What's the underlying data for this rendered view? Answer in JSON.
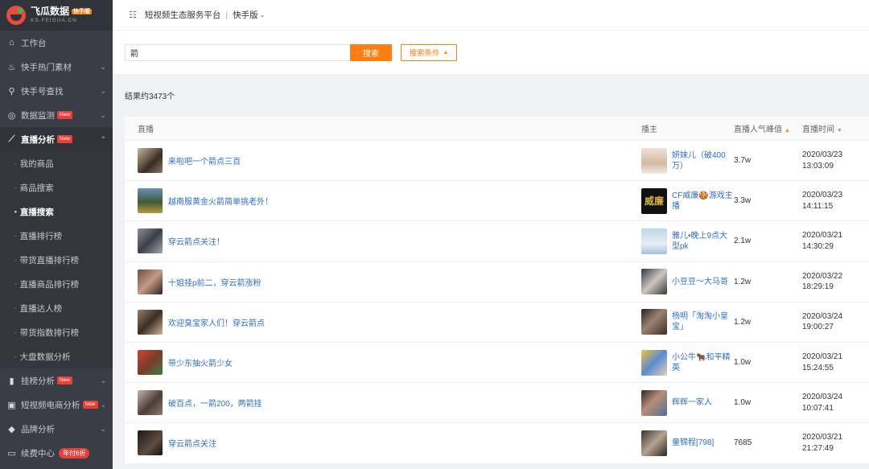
{
  "brand": {
    "name": "飞瓜数据",
    "badge": "快手版",
    "domain": "KS.FEIGUA.CN"
  },
  "sidebar": {
    "items": [
      {
        "label": "工作台",
        "icon": "home-icon",
        "glyph": "⌂",
        "caret": ""
      },
      {
        "label": "快手热门素材",
        "icon": "flame-icon",
        "glyph": "♨",
        "caret": "⌄"
      },
      {
        "label": "快手号查找",
        "icon": "search-icon",
        "glyph": "⚲",
        "caret": "⌄"
      },
      {
        "label": "数据监测",
        "icon": "monitor-icon",
        "glyph": "◎",
        "caret": "⌄",
        "badge": "New"
      },
      {
        "label": "直播分析",
        "icon": "trend-icon",
        "glyph": "⟋",
        "caret": "⌃",
        "badge": "New"
      }
    ],
    "sub_items": [
      {
        "label": "我的商品",
        "dot": "·"
      },
      {
        "label": "商品搜索",
        "dot": "·"
      },
      {
        "label": "直播搜索",
        "dot": "•"
      },
      {
        "label": "直播排行榜",
        "dot": "·"
      },
      {
        "label": "带货直播排行榜",
        "dot": "·"
      },
      {
        "label": "直播商品排行榜",
        "dot": "·"
      },
      {
        "label": "直播达人榜",
        "dot": "·"
      },
      {
        "label": "带货指数排行榜",
        "dot": "·"
      },
      {
        "label": "大盘数据分析",
        "dot": "·"
      }
    ],
    "bottom_items": [
      {
        "label": "挂榜分析",
        "icon": "bar-chart-icon",
        "glyph": "▮",
        "caret": "⌄",
        "badge": "New"
      },
      {
        "label": "短视频电商分析",
        "icon": "bag-icon",
        "glyph": "▣",
        "caret": "⌄",
        "badge": "New"
      },
      {
        "label": "品牌分析",
        "icon": "diamond-icon",
        "glyph": "◆",
        "caret": "⌄"
      },
      {
        "label": "续费中心",
        "icon": "card-icon",
        "glyph": "▭",
        "caret": "",
        "pill": "年付6折"
      }
    ]
  },
  "topbar": {
    "menu_icon": "☷",
    "platform": "短视频生态服务平台",
    "separator": "|",
    "version": "快手版",
    "chevron": "⌄"
  },
  "search": {
    "value": "箭",
    "button": "搜索",
    "conditions": "搜索条件",
    "conditions_arrow": "▲"
  },
  "results": {
    "count_text": "结果约3473个",
    "columns": {
      "live": "直播",
      "host": "播主",
      "popularity": "直播人气峰值",
      "popularity_sort": "▲",
      "time": "直播时间",
      "time_sort": "▼"
    },
    "rows": [
      {
        "title": "来啦吧一个箭点三百",
        "host": "妍妹儿（破400万）",
        "popularity": "3.7w",
        "date": "2020/03/23",
        "time": "13:03:09"
      },
      {
        "title": "越南服黄金火箭简单挑老外！",
        "host": "CF威廉🍪游戏主播",
        "host_avatar_text": "威廉",
        "popularity": "3.3w",
        "date": "2020/03/23",
        "time": "14:11:15"
      },
      {
        "title": "穿云箭点关注！",
        "host": "雅儿•晚上9点大型pk",
        "popularity": "2.1w",
        "date": "2020/03/21",
        "time": "14:30:29"
      },
      {
        "title": "十姐挂p前二，穿云箭涨粉",
        "host": "小豆豆～大马哥",
        "popularity": "1.2w",
        "date": "2020/03/22",
        "time": "18:29:19"
      },
      {
        "title": "欢迎臭宝家人们！穿云箭点",
        "host": "杨明「淘淘小皇宝」",
        "popularity": "1.2w",
        "date": "2020/03/24",
        "time": "19:00:27"
      },
      {
        "title": "带少东抽火箭少女",
        "host": "小公牛🐂和平精英",
        "popularity": "1.0w",
        "date": "2020/03/21",
        "time": "15:24:55"
      },
      {
        "title": "破百点，一箭200，两箭挂",
        "host": "辉辉一家人",
        "popularity": "1.0w",
        "date": "2020/03/24",
        "time": "10:07:41"
      },
      {
        "title": "穿云箭点关注",
        "host": "童锦程[798]",
        "popularity": "7685",
        "date": "2020/03/21",
        "time": "21:27:49"
      }
    ]
  }
}
